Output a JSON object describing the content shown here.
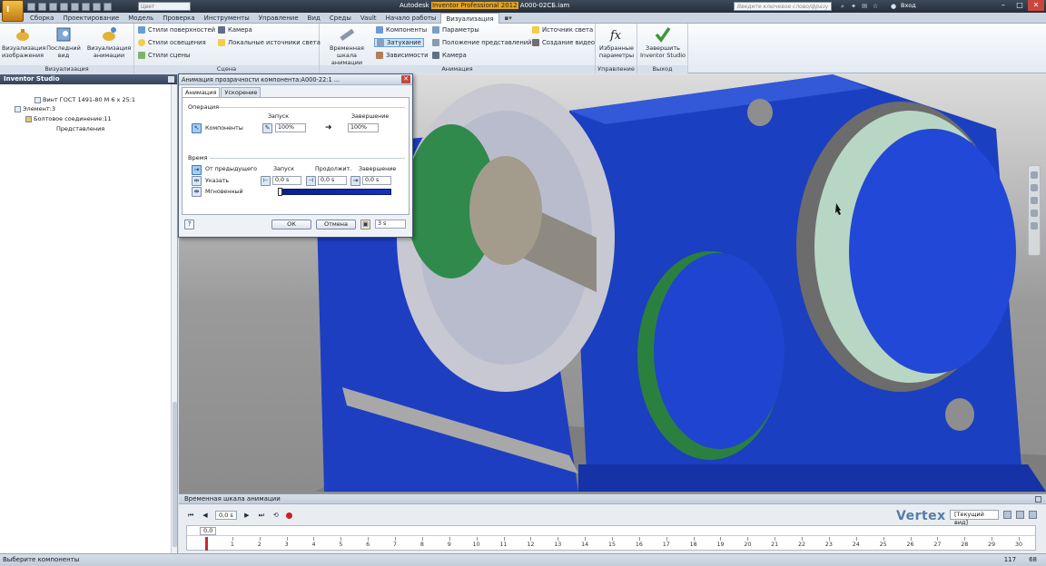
{
  "titlebar": {
    "app_letter": "I",
    "title_prefix": "Autodesk ",
    "title_highlight": "Inventor Professional 2012",
    "title_suffix": "   A000-02СБ.iam",
    "qat_select": "Цвет",
    "search_placeholder": "Введите ключевое слово/фразу",
    "sign_in": "Вход",
    "minimize": "–",
    "maximize": "□",
    "close": "✕"
  },
  "ribbon_tabs": [
    "Сборка",
    "Проектирование",
    "Модель",
    "Проверка",
    "Инструменты",
    "Управление",
    "Вид",
    "Среды",
    "Vault",
    "Начало работы",
    "Визуализация"
  ],
  "ribbon_tab_extra": "▪▾",
  "ribbon": {
    "panels": {
      "vis": "Визуализация",
      "scene": "Сцена",
      "anim": "Анимация",
      "manage": "Управление",
      "exit": "Выход"
    },
    "big_buttons": {
      "render_image": "Визуализация изображения",
      "last_view": "Последний вид",
      "render_anim": "Визуализация анимации",
      "timeline": "Временная шкала анимации",
      "fav_params": "Избранные параметры",
      "finish": "Завершить Inventor Studio"
    },
    "scene_items": {
      "surface": "Стили поверхностей",
      "lighting": "Стили освещения",
      "scene_styles": "Стили сцены",
      "camera": "Камера",
      "local_lights": "Локальные источники света"
    },
    "anim_items": {
      "components": "Компоненты",
      "fade": "Затухание",
      "constraints": "Зависимости",
      "parameters": "Параметры",
      "pos_reps": "Положение представлений",
      "camera": "Камера",
      "light": "Источник света",
      "video": "Создание видео"
    }
  },
  "browser": {
    "header": "Inventor Studio",
    "items": [
      "Винт ГОСТ 1491-80 М 6 х 25:1",
      "Элемент:3",
      "Болтовое соединение:11",
      "Представления"
    ]
  },
  "dialog": {
    "title": "Анимация прозрачности компонента:А000-22:1 ...",
    "close": "✕",
    "tabs": [
      "Анимация",
      "Ускорение"
    ],
    "operation_label": "Операция",
    "start_label": "Запуск",
    "end_label": "Завершение",
    "components_label": "Компоненты",
    "start_value": "100%",
    "end_value": "100%",
    "arrow": "➜",
    "time_label": "Время",
    "from_prev": "От предыдущего",
    "specify": "Указать",
    "instant": "Мгновенный",
    "col_start": "Запуск",
    "col_duration": "Продолжит.",
    "col_end": "Завершение",
    "t_start": "0,0 s",
    "t_duration": "0,0 s",
    "t_end": "0,0 s",
    "ok": "ОК",
    "cancel": "Отмена",
    "duration_value": "3 s"
  },
  "timeline": {
    "header": "Временная шкала анимации",
    "current_time": "0,0 s",
    "ruler_current": "0,0",
    "view_select": "[Текущий вид]",
    "ticks": [
      "0",
      "1",
      "2",
      "3",
      "4",
      "5",
      "6",
      "7",
      "8",
      "9",
      "10",
      "11",
      "12",
      "13",
      "14",
      "15",
      "16",
      "17",
      "18",
      "19",
      "20",
      "21",
      "22",
      "23",
      "24",
      "25",
      "26",
      "27",
      "28",
      "29",
      "30"
    ]
  },
  "watermark": "Vertex",
  "status": {
    "message": "Выберите компоненты",
    "num1": "117",
    "num2": "68"
  },
  "colors": {
    "part_blue": "#1a3fc0",
    "gear_green": "#2f8a4c",
    "accent_orange": "#e6a41d"
  }
}
